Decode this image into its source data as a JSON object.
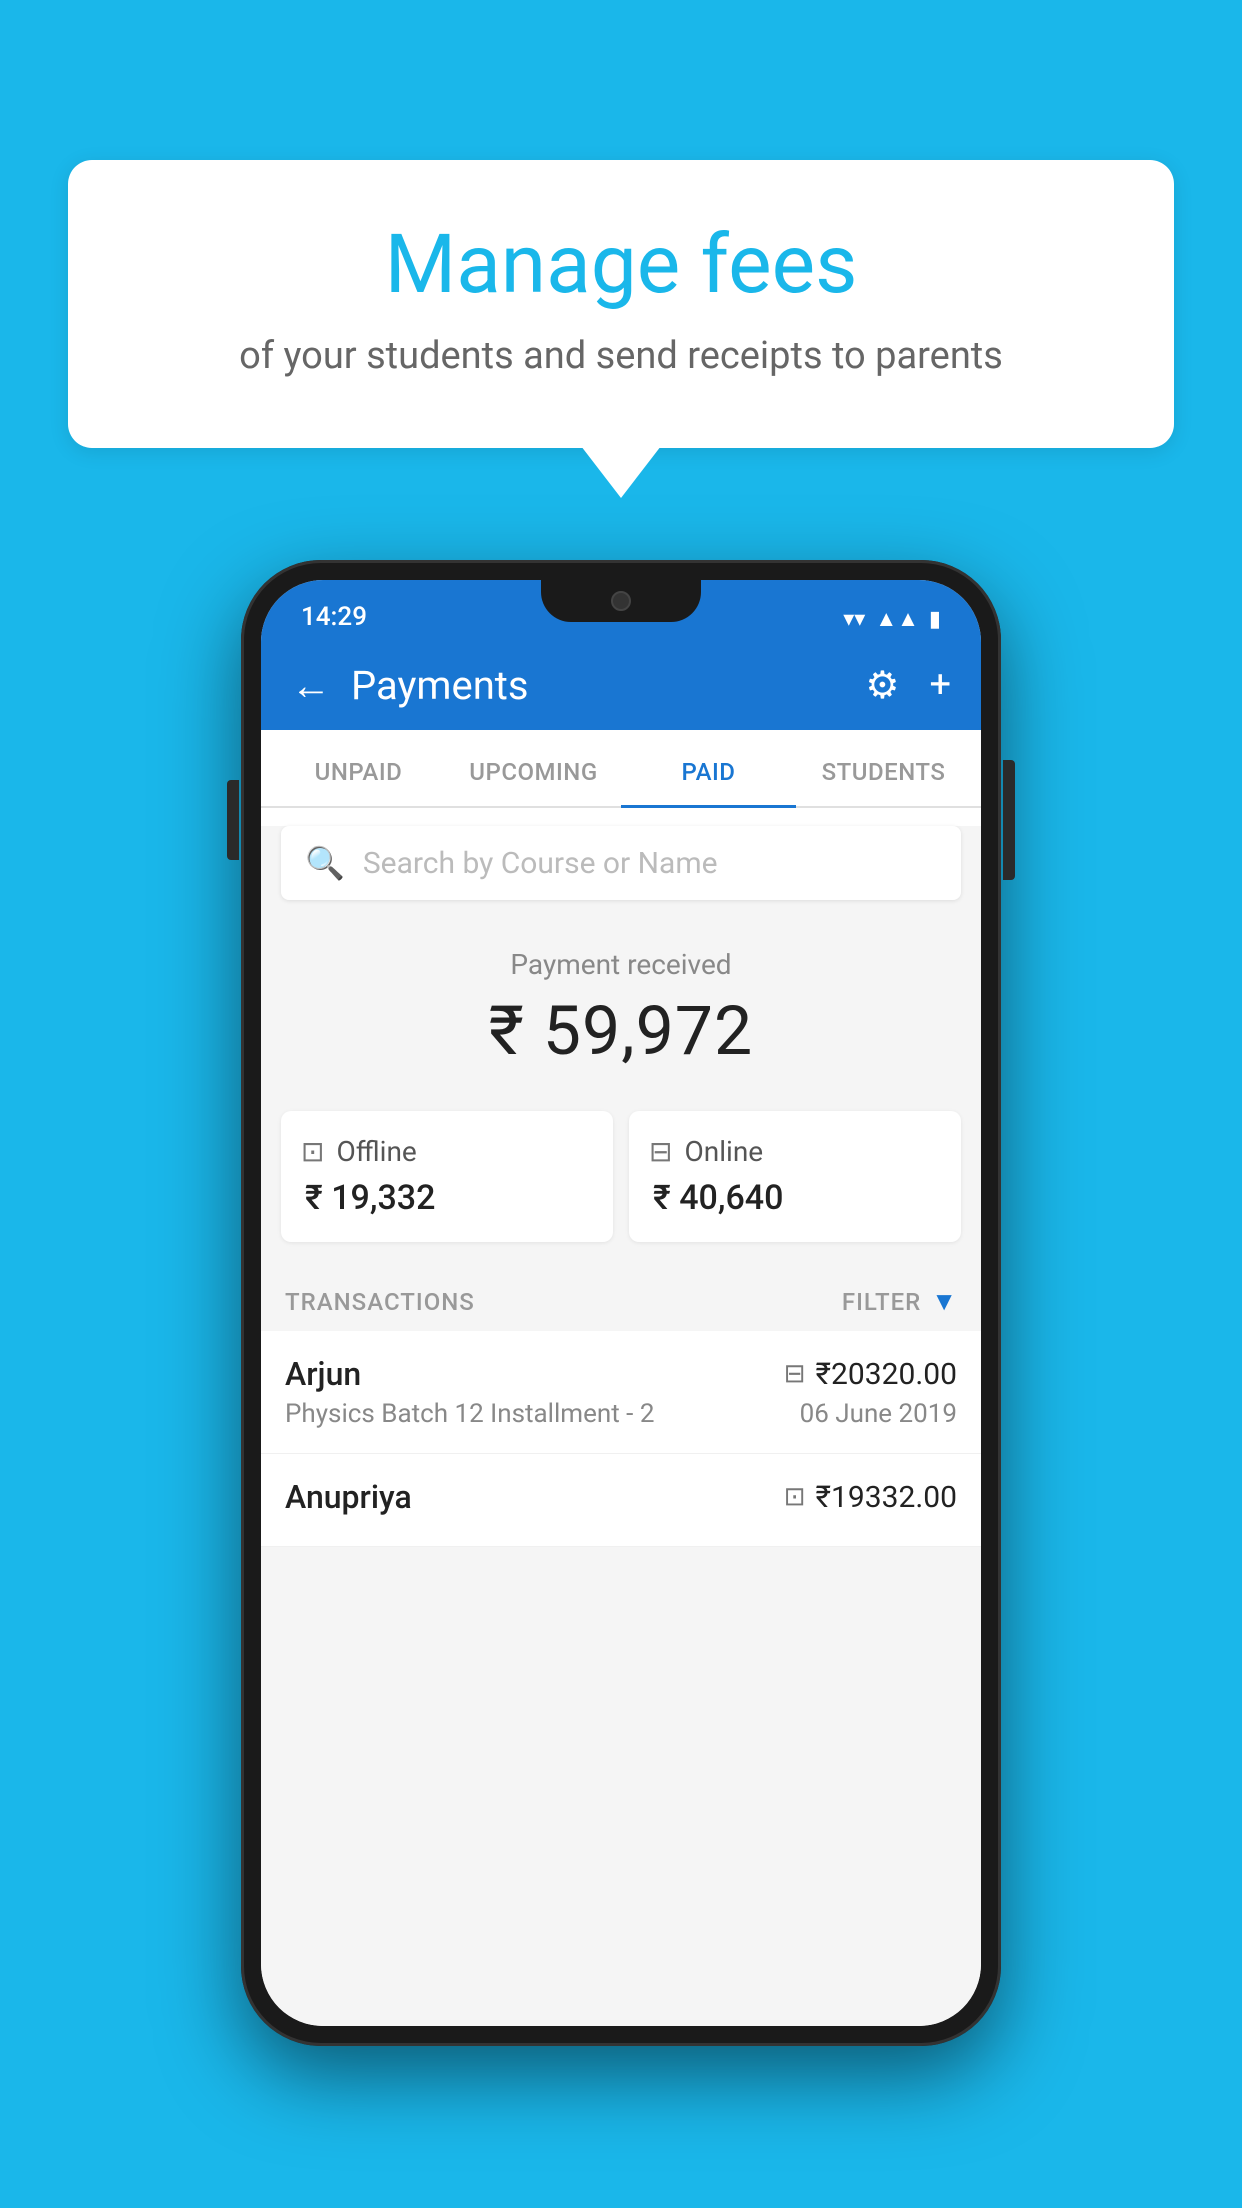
{
  "background_color": "#1ab7ea",
  "speech_bubble": {
    "title": "Manage fees",
    "subtitle": "of your students and send receipts to parents"
  },
  "phone": {
    "status_bar": {
      "time": "14:29",
      "icons": [
        "wifi",
        "signal",
        "battery"
      ]
    },
    "app_bar": {
      "title": "Payments",
      "back_label": "←",
      "gear_label": "⚙",
      "plus_label": "+"
    },
    "tabs": [
      {
        "label": "UNPAID",
        "active": false
      },
      {
        "label": "UPCOMING",
        "active": false
      },
      {
        "label": "PAID",
        "active": true
      },
      {
        "label": "STUDENTS",
        "active": false
      }
    ],
    "search": {
      "placeholder": "Search by Course or Name"
    },
    "payment_received": {
      "label": "Payment received",
      "amount": "₹ 59,972"
    },
    "payment_cards": [
      {
        "type": "Offline",
        "amount": "₹ 19,332",
        "icon": "offline"
      },
      {
        "type": "Online",
        "amount": "₹ 40,640",
        "icon": "online"
      }
    ],
    "transactions_section": {
      "label": "TRANSACTIONS",
      "filter_label": "FILTER"
    },
    "transactions": [
      {
        "name": "Arjun",
        "course": "Physics Batch 12 Installment - 2",
        "amount": "₹20320.00",
        "date": "06 June 2019",
        "payment_type": "online"
      },
      {
        "name": "Anupriya",
        "course": "",
        "amount": "₹19332.00",
        "date": "",
        "payment_type": "offline"
      }
    ]
  }
}
